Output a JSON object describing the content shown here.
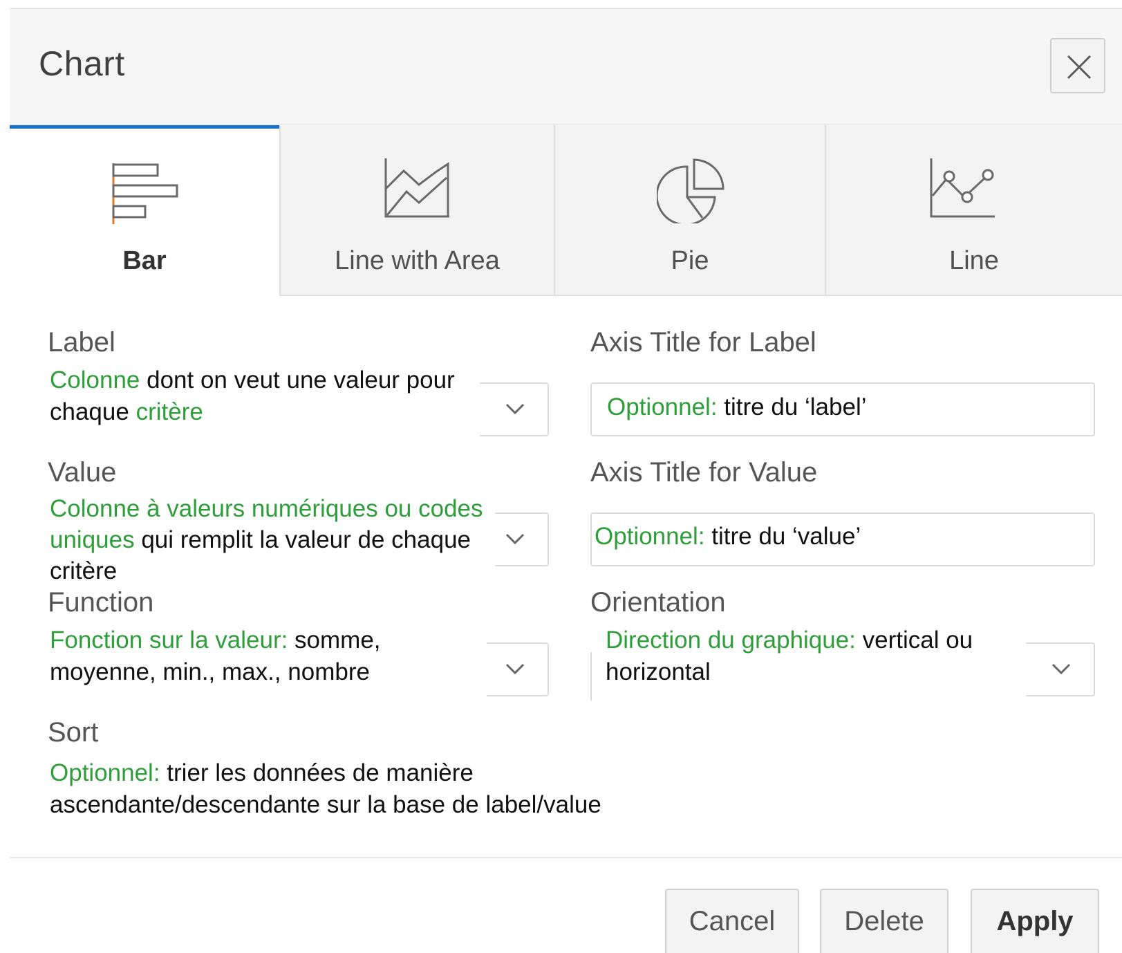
{
  "dialog": {
    "title": "Chart",
    "close_icon": "close-icon"
  },
  "tabs": [
    {
      "label": "Bar",
      "icon": "bar-chart-icon",
      "active": true
    },
    {
      "label": "Line with Area",
      "icon": "area-chart-icon",
      "active": false
    },
    {
      "label": "Pie",
      "icon": "pie-chart-icon",
      "active": false
    },
    {
      "label": "Line",
      "icon": "line-chart-icon",
      "active": false
    }
  ],
  "fields": {
    "label": {
      "title": "Label",
      "help_green_1": "Colonne",
      "help_text_1": " dont on veut une valeur pour chaque ",
      "help_green_2": "critère"
    },
    "axis_title_label": {
      "title": "Axis Title for Label",
      "help_green": "Optionnel:",
      "help_text": " titre du ‘label’"
    },
    "value": {
      "title": "Value",
      "help_green": "Colonne à valeurs numériques ou codes uniques",
      "help_text": " qui remplit la valeur de chaque critère"
    },
    "axis_title_value": {
      "title": "Axis Title for Value",
      "help_green": "Optionnel:",
      "help_text": " titre du ‘value’"
    },
    "function": {
      "title": "Function",
      "help_green": "Fonction sur la valeur:",
      "help_text": " somme, moyenne, min., max., nombre"
    },
    "orientation": {
      "title": "Orientation",
      "help_green": "Direction du graphique:",
      "help_text": " vertical ou horizontal"
    },
    "sort": {
      "title": "Sort",
      "help_green": "Optionnel:",
      "help_text": " trier les données de manière ascendante/descendante sur la base de label/value"
    }
  },
  "colors": {
    "accent": "#1a73c9",
    "help_green": "#2e9e3a"
  },
  "buttons": {
    "cancel": "Cancel",
    "delete": "Delete",
    "apply": "Apply"
  }
}
